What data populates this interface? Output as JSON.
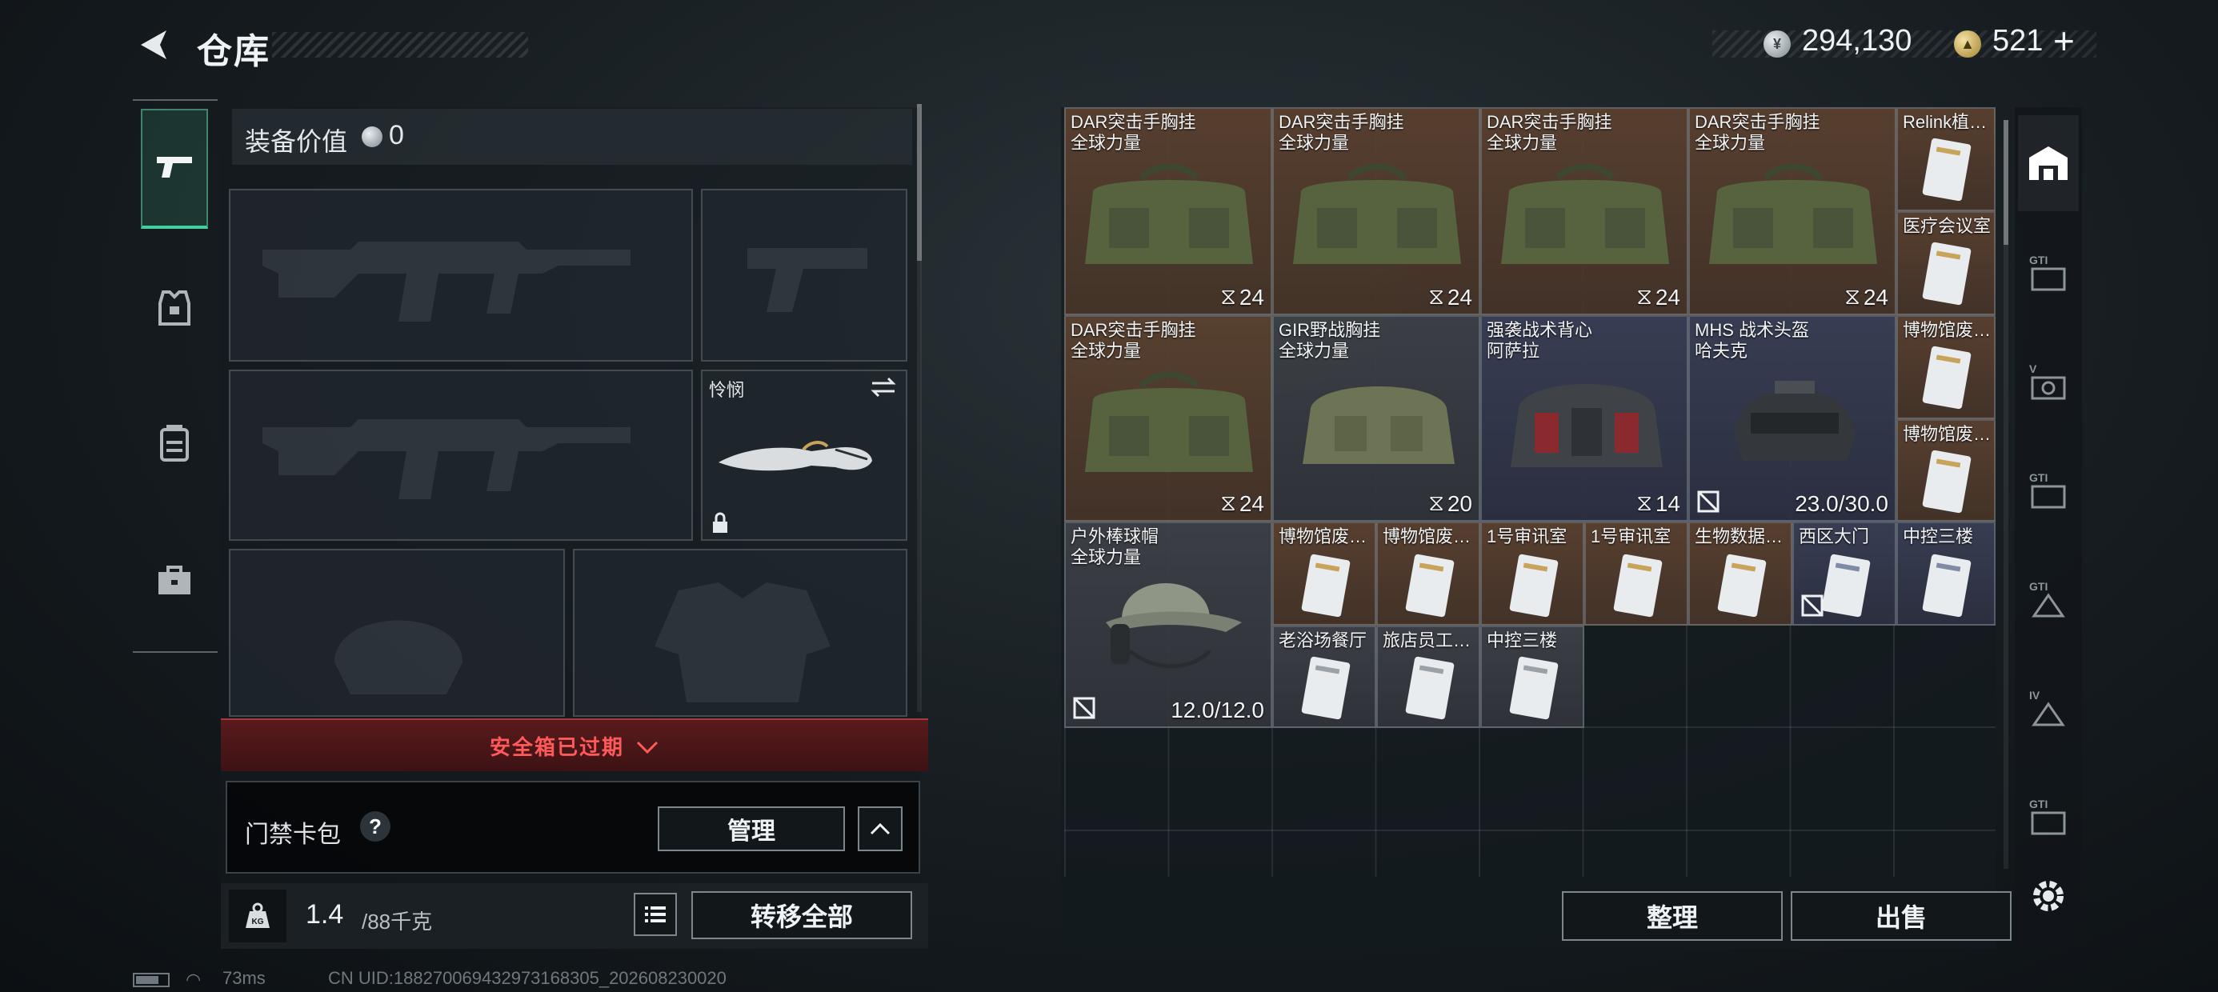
{
  "header": {
    "title": "仓库",
    "currency_silver": "294,130",
    "currency_gold": "521",
    "add_symbol": "+"
  },
  "equipment": {
    "value_label": "装备价值",
    "value": "0",
    "melee_slot_label": "怜悯",
    "safe_box_status": "安全箱已过期"
  },
  "keycard": {
    "label": "门禁卡包",
    "help": "?",
    "manage_label": "管理"
  },
  "weight": {
    "current": "1.4",
    "max": "/88千克",
    "transfer_label": "转移全部"
  },
  "status": {
    "ping": "73ms",
    "uid": "CN UID:18827006943297316830​5_202608230020"
  },
  "storage": {
    "sort_label": "整理",
    "sell_label": "出售",
    "items": [
      {
        "name": "DAR突击手胸挂",
        "sub": "全球力量",
        "count": "24"
      },
      {
        "name": "DAR突击手胸挂",
        "sub": "全球力量",
        "count": "24"
      },
      {
        "name": "DAR突击手胸挂",
        "sub": "全球力量",
        "count": "24"
      },
      {
        "name": "DAR突击手胸挂",
        "sub": "全球力量",
        "count": "24"
      },
      {
        "name": "DAR突击手胸挂",
        "sub": "全球力量",
        "count": "24"
      },
      {
        "name": "GIR野战胸挂",
        "sub": "全球力量",
        "count": "20"
      },
      {
        "name": "强袭战术背心",
        "sub": "阿萨拉",
        "count": "14"
      },
      {
        "name": "MHS 战术头盔",
        "sub": "哈夫克",
        "durability": "23.0/30.0"
      },
      {
        "name": "户外棒球帽",
        "sub": "全球力量",
        "durability": "12.0/12.0"
      }
    ],
    "cards": [
      "Relink植…",
      "医疗会议室",
      "博物馆废…",
      "博物馆废…",
      "博物馆废…",
      "博物馆废…",
      "1号审讯室",
      "1号审讯室",
      "生物数据…",
      "西区大门",
      "中控三楼",
      "老浴场餐厅",
      "旅店员工…",
      "中控三楼"
    ]
  },
  "colors": {
    "accent": "#3fd1a0",
    "alert": "#ff5a5a",
    "brown_rarity": "#5c4230",
    "blue_rarity": "#3a4056"
  }
}
